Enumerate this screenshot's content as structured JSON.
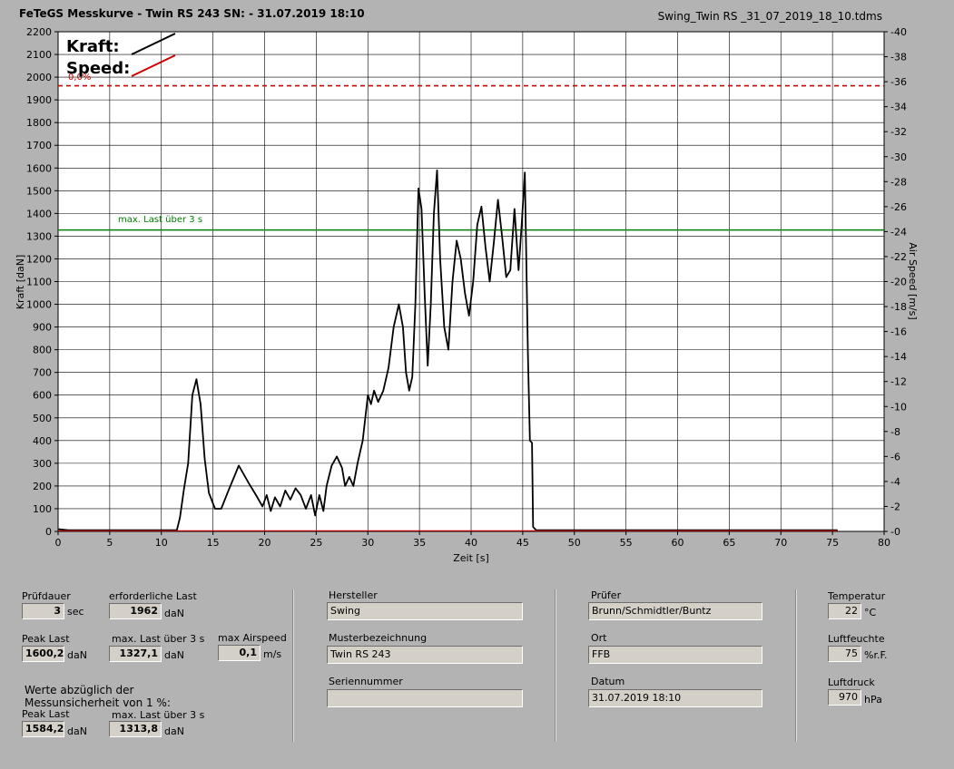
{
  "header": {
    "title": "FeTeGS Messkurve - Twin RS 243  SN:  - 31.07.2019 18:10",
    "filename": "Swing_Twin RS _31_07_2019_18_10.tdms"
  },
  "chart_data": {
    "type": "line",
    "xlabel": "Zeit [s]",
    "ylabel": "Kraft [daN]",
    "y2label": "Air Speed [m/s]",
    "xlim": [
      0,
      80
    ],
    "ylim": [
      0,
      2200
    ],
    "y2lim": [
      0,
      40
    ],
    "x_ticks": [
      0,
      5,
      10,
      15,
      20,
      25,
      30,
      35,
      40,
      45,
      50,
      55,
      60,
      65,
      70,
      75,
      80
    ],
    "y_ticks": [
      0,
      100,
      200,
      300,
      400,
      500,
      600,
      700,
      800,
      900,
      1000,
      1100,
      1200,
      1300,
      1400,
      1500,
      1600,
      1700,
      1800,
      1900,
      2000,
      2100,
      2200
    ],
    "y2_ticks": [
      0,
      2,
      4,
      6,
      8,
      10,
      12,
      14,
      16,
      18,
      20,
      22,
      24,
      26,
      28,
      30,
      32,
      34,
      36,
      38,
      40
    ],
    "grid": true,
    "legend": [
      {
        "name": "Kraft:",
        "color": "#000000"
      },
      {
        "name": "Speed:",
        "color": "#cc0000"
      }
    ],
    "reference_lines": [
      {
        "y": 1962,
        "color": "#cc0000",
        "style": "dashed",
        "label": "erforderliche Last"
      },
      {
        "y": 1327.1,
        "color": "#008000",
        "style": "solid",
        "label": "max. Last über  3 s"
      }
    ],
    "series": [
      {
        "name": "Kraft:",
        "color": "#000000",
        "points": [
          [
            0,
            10
          ],
          [
            1,
            5
          ],
          [
            5,
            5
          ],
          [
            9,
            5
          ],
          [
            10,
            5
          ],
          [
            11.5,
            5
          ],
          [
            11.8,
            60
          ],
          [
            12.2,
            190
          ],
          [
            12.6,
            300
          ],
          [
            13.0,
            600
          ],
          [
            13.4,
            670
          ],
          [
            13.8,
            560
          ],
          [
            14.2,
            320
          ],
          [
            14.6,
            170
          ],
          [
            15.2,
            100
          ],
          [
            15.8,
            100
          ],
          [
            16.5,
            180
          ],
          [
            17.5,
            290
          ],
          [
            18.5,
            210
          ],
          [
            19.3,
            150
          ],
          [
            19.8,
            110
          ],
          [
            20.2,
            160
          ],
          [
            20.6,
            90
          ],
          [
            21.0,
            150
          ],
          [
            21.5,
            110
          ],
          [
            22.0,
            180
          ],
          [
            22.5,
            140
          ],
          [
            23.0,
            190
          ],
          [
            23.5,
            160
          ],
          [
            24.0,
            100
          ],
          [
            24.5,
            160
          ],
          [
            24.9,
            70
          ],
          [
            25.3,
            160
          ],
          [
            25.7,
            90
          ],
          [
            26.0,
            200
          ],
          [
            26.5,
            290
          ],
          [
            27.0,
            330
          ],
          [
            27.5,
            280
          ],
          [
            27.8,
            200
          ],
          [
            28.2,
            240
          ],
          [
            28.6,
            200
          ],
          [
            29.0,
            300
          ],
          [
            29.5,
            400
          ],
          [
            30.0,
            600
          ],
          [
            30.3,
            560
          ],
          [
            30.6,
            620
          ],
          [
            31.0,
            570
          ],
          [
            31.5,
            620
          ],
          [
            32.0,
            720
          ],
          [
            32.5,
            900
          ],
          [
            33.0,
            1000
          ],
          [
            33.4,
            900
          ],
          [
            33.7,
            700
          ],
          [
            34.0,
            620
          ],
          [
            34.3,
            680
          ],
          [
            34.6,
            1000
          ],
          [
            34.9,
            1510
          ],
          [
            35.2,
            1420
          ],
          [
            35.5,
            1050
          ],
          [
            35.8,
            730
          ],
          [
            36.1,
            1000
          ],
          [
            36.4,
            1400
          ],
          [
            36.7,
            1590
          ],
          [
            37.0,
            1200
          ],
          [
            37.4,
            900
          ],
          [
            37.8,
            800
          ],
          [
            38.2,
            1100
          ],
          [
            38.6,
            1280
          ],
          [
            39.0,
            1200
          ],
          [
            39.4,
            1050
          ],
          [
            39.8,
            950
          ],
          [
            40.2,
            1100
          ],
          [
            40.6,
            1350
          ],
          [
            41.0,
            1430
          ],
          [
            41.4,
            1250
          ],
          [
            41.8,
            1100
          ],
          [
            42.2,
            1270
          ],
          [
            42.6,
            1460
          ],
          [
            43.0,
            1300
          ],
          [
            43.4,
            1120
          ],
          [
            43.8,
            1150
          ],
          [
            44.2,
            1420
          ],
          [
            44.6,
            1150
          ],
          [
            44.9,
            1350
          ],
          [
            45.2,
            1580
          ],
          [
            45.5,
            780
          ],
          [
            45.7,
            400
          ],
          [
            45.9,
            390
          ],
          [
            46.0,
            20
          ],
          [
            46.3,
            5
          ],
          [
            50,
            5
          ],
          [
            60,
            5
          ],
          [
            70,
            5
          ],
          [
            75.5,
            5
          ]
        ]
      },
      {
        "name": "Speed:",
        "color": "#cc0000",
        "points": [
          [
            0,
            0.05
          ],
          [
            75.5,
            0.05
          ]
        ]
      }
    ]
  },
  "labels": {
    "chart_red_label": "0,0%",
    "chart_green_label": "max. Last über  3 s"
  },
  "panel": {
    "pruefdauer": {
      "label": "Prüfdauer",
      "value": "3",
      "unit": "sec"
    },
    "erforderliche_last": {
      "label": "erforderliche Last",
      "value": "1962",
      "unit": "daN"
    },
    "peak_last": {
      "label": "Peak Last",
      "value": "1600,2",
      "unit": "daN"
    },
    "max_last": {
      "label": "max. Last über  3 s",
      "value": "1327,1",
      "unit": "daN"
    },
    "max_airspeed": {
      "label": "max Airspeed",
      "value": "0,1",
      "unit": "m/s"
    },
    "werte_note_1": "Werte abzüglich der",
    "werte_note_2": "Messunsicherheit von 1  %:",
    "peak_last_corr": {
      "label": "Peak Last",
      "value": "1584,2",
      "unit": "daN"
    },
    "max_last_corr": {
      "label": "max. Last über  3 s",
      "value": "1313,8",
      "unit": "daN"
    },
    "hersteller": {
      "label": "Hersteller",
      "value": "Swing"
    },
    "musterbezeichnung": {
      "label": "Musterbezeichnung",
      "value": "Twin RS 243"
    },
    "seriennummer": {
      "label": "Seriennummer",
      "value": ""
    },
    "pruefer": {
      "label": "Prüfer",
      "value": "Brunn/Schmidtler/Buntz"
    },
    "ort": {
      "label": "Ort",
      "value": "FFB"
    },
    "datum": {
      "label": "Datum",
      "value": "31.07.2019 18:10"
    },
    "temperatur": {
      "label": "Temperatur",
      "value": "22",
      "unit": "°C"
    },
    "luftfeuchte": {
      "label": "Luftfeuchte",
      "value": "75",
      "unit": "%r.F."
    },
    "luftdruck": {
      "label": "Luftdruck",
      "value": "970",
      "unit": "hPa"
    }
  }
}
